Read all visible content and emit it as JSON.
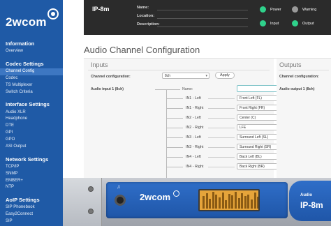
{
  "logo": {
    "text": "2wcom"
  },
  "sidebar": {
    "groups": [
      {
        "heading": "Information",
        "items": [
          "Overview"
        ]
      },
      {
        "heading": "Codec Settings",
        "items": [
          "Channel Config",
          "Codec",
          "TS Multiplexer",
          "Switch Criteria"
        ]
      },
      {
        "heading": "Interface Settings",
        "items": [
          "Audio XLR",
          "Headphone",
          "DTE",
          "GPI",
          "GPO",
          "ASI Output"
        ]
      },
      {
        "heading": "Network Settings",
        "items": [
          "TCP/IP",
          "SNMP",
          "EMBER+",
          "NTP"
        ]
      },
      {
        "heading": "AoIP Settings",
        "items": [
          "SIP Phonebook",
          "Easy2Connect",
          "SIP"
        ]
      }
    ],
    "active_item": "Channel Config"
  },
  "statusbar": {
    "device": "IP-8m",
    "name_label": "Name:",
    "location_label": "Location:",
    "description_label": "Description:",
    "indicators": [
      {
        "label": "Power",
        "color": "#2fd18b"
      },
      {
        "label": "Warning",
        "color": "#9a9a9a"
      },
      {
        "label": "Input",
        "color": "#2fd18b"
      },
      {
        "label": "Output",
        "color": "#2fd18b"
      }
    ]
  },
  "main": {
    "title": "Audio Channel Configuration",
    "inputs": {
      "title": "Inputs",
      "config_label": "Channel configuration:",
      "config_value": "8ch",
      "apply_label": "Apply",
      "header": "Audio input 1 (8ch)",
      "name_label": "Name:",
      "name_value": "",
      "rows": [
        {
          "label": "IN1 - Left",
          "value": "Front Left (FL)"
        },
        {
          "label": "IN1 - Right",
          "value": "Front Right (FR)"
        },
        {
          "label": "IN2 - Left",
          "value": "Center (C)"
        },
        {
          "label": "IN2 - Right",
          "value": "LFE"
        },
        {
          "label": "IN3 - Left",
          "value": "Surround Left (SL)"
        },
        {
          "label": "IN3 - Right",
          "value": "Surround Right (SR)"
        },
        {
          "label": "IN4 - Left",
          "value": "Back Left (BL)"
        },
        {
          "label": "IN4 - Right",
          "value": "Back Right (BR)"
        }
      ]
    },
    "outputs": {
      "title": "Outputs",
      "config_label": "Channel configuration:",
      "header": "Audio output 1 (8ch)"
    }
  },
  "hardware": {
    "logo": "2wcom",
    "side_small": "Audio",
    "side_big": "IP-8m"
  }
}
